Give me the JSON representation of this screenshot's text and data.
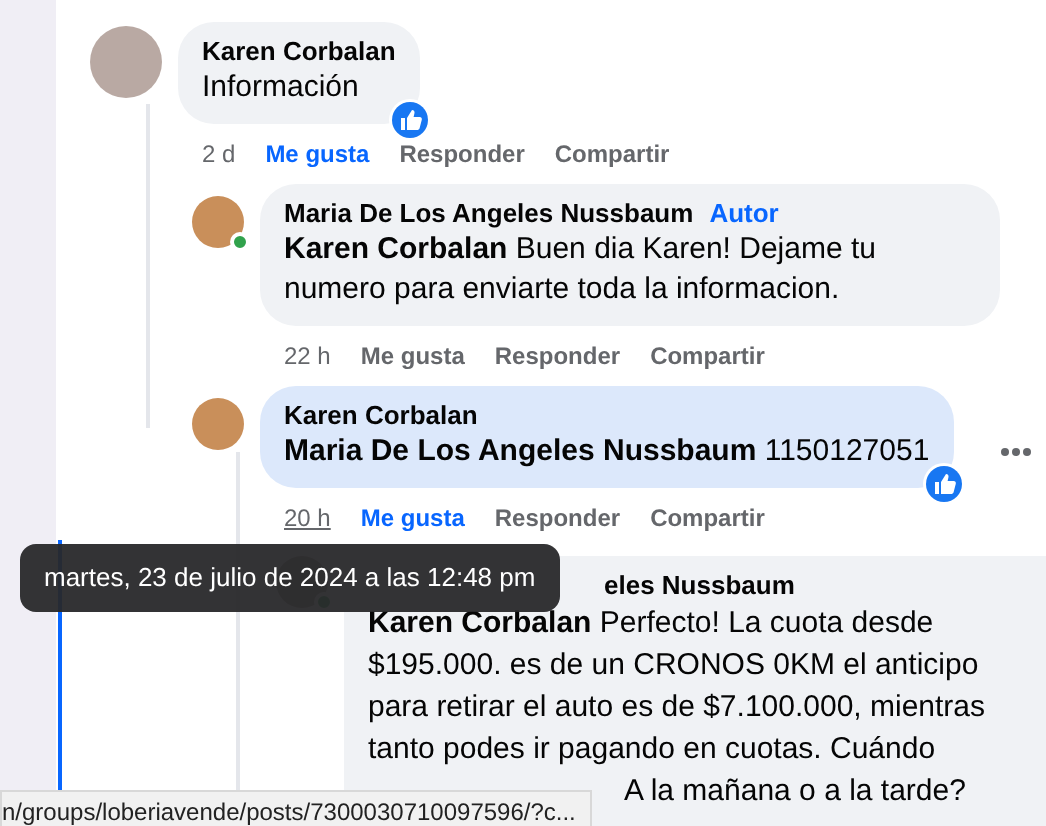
{
  "comments": [
    {
      "author": "Karen Corbalan",
      "text": "Información",
      "online": false,
      "highlighted": false,
      "reacted": true,
      "more_menu": false,
      "actions": {
        "time": "2 d",
        "time_underlined": false,
        "like": "Me gusta",
        "liked": true,
        "reply": "Responder",
        "share": "Compartir"
      },
      "children": [
        {
          "author": "Maria De Los Angeles Nussbaum",
          "author_badge": "Autor",
          "text": "**Karen Corbalan** Buen dia Karen! Dejame tu numero para enviarte toda la informacion.",
          "online": true,
          "highlighted": false,
          "reacted": false,
          "more_menu": false,
          "actions": {
            "time": "22 h",
            "time_underlined": false,
            "like": "Me gusta",
            "liked": false,
            "reply": "Responder",
            "share": "Compartir"
          }
        },
        {
          "author": "Karen Corbalan",
          "text": "**Maria De Los Angeles Nussbaum** 1150127051",
          "online": false,
          "highlighted": true,
          "reacted": true,
          "more_menu": true,
          "actions": {
            "time": "20 h",
            "time_underlined": true,
            "like": "Me gusta",
            "liked": true,
            "reply": "Responder",
            "share": "Compartir"
          },
          "children": [
            {
              "author": "eles Nussbaum",
              "text": "**Karen Corbalan** Perfecto! La cuota desde $195.000. es de un CRONOS 0KM el anticipo para retirar el auto es de $7.100.000, mientras tanto podes ir pagando en cuotas. Cuándo",
              "text_tail": "A la mañana o a la tarde?",
              "online": true,
              "highlighted": false,
              "reacted": false,
              "more_menu": false
            }
          ]
        }
      ]
    }
  ],
  "tooltip": "martes, 23 de julio de 2024 a las 12:48 pm",
  "status_bar": "n/groups/loberiavende/posts/7300030710097596/?c..."
}
